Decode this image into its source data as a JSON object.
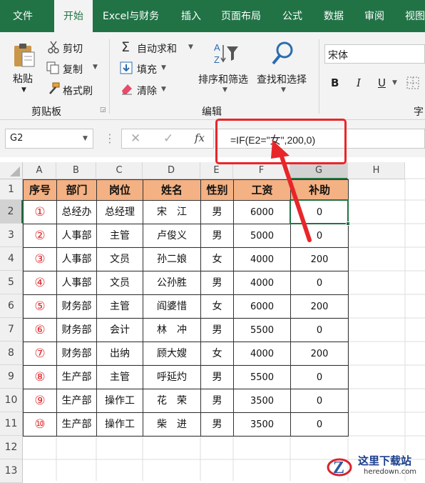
{
  "tabs": [
    "文件",
    "开始",
    "Excel与财务",
    "插入",
    "页面布局",
    "公式",
    "数据",
    "审阅",
    "视图"
  ],
  "ribbon": {
    "paste": "粘贴",
    "cut": "剪切",
    "copy": "复制",
    "format_painter": "格式刷",
    "clipboard": "剪贴板",
    "autosum": "自动求和",
    "fill": "填充",
    "clear": "清除",
    "sort_filter": "排序和筛选",
    "find_select": "查找和选择",
    "editing": "编辑",
    "font_name": "宋体",
    "bold": "B",
    "italic": "I",
    "underline": "U",
    "font_group": "字"
  },
  "formula_bar": {
    "namebox": "G2",
    "cancel": "✕",
    "enter": "✓",
    "fx": "fx",
    "formula_prefix": "=IF(E2=\"",
    "formula_nv": "女",
    "formula_suffix": "\",200,0)"
  },
  "annotation_color": "#e8262a",
  "header_fill": "#f4b183",
  "col_letters": [
    "A",
    "B",
    "C",
    "D",
    "E",
    "F",
    "G",
    "H"
  ],
  "rows": [
    "1",
    "2",
    "3",
    "4",
    "5",
    "6",
    "7",
    "8",
    "9",
    "10",
    "11",
    "12",
    "13"
  ],
  "table": {
    "headers": [
      "序号",
      "部门",
      "岗位",
      "姓名",
      "性别",
      "工资",
      "补助"
    ],
    "data": [
      [
        "①",
        "总经办",
        "总经理",
        "宋　江",
        "男",
        "6000",
        "0"
      ],
      [
        "②",
        "人事部",
        "主管",
        "卢俊义",
        "男",
        "5000",
        "0"
      ],
      [
        "③",
        "人事部",
        "文员",
        "孙二娘",
        "女",
        "4000",
        "200"
      ],
      [
        "④",
        "人事部",
        "文员",
        "公孙胜",
        "男",
        "4000",
        "0"
      ],
      [
        "⑤",
        "财务部",
        "主管",
        "阎婆惜",
        "女",
        "6000",
        "200"
      ],
      [
        "⑥",
        "财务部",
        "会计",
        "林　冲",
        "男",
        "5500",
        "0"
      ],
      [
        "⑦",
        "财务部",
        "出纳",
        "顾大嫂",
        "女",
        "4000",
        "200"
      ],
      [
        "⑧",
        "生产部",
        "主管",
        "呼延灼",
        "男",
        "5500",
        "0"
      ],
      [
        "⑨",
        "生产部",
        "操作工",
        "花　荣",
        "男",
        "3500",
        "0"
      ],
      [
        "⑩",
        "生产部",
        "操作工",
        "柴　进",
        "男",
        "3500",
        "0"
      ]
    ]
  },
  "watermark": {
    "name": "这里下载站",
    "url": "heredown.com"
  }
}
